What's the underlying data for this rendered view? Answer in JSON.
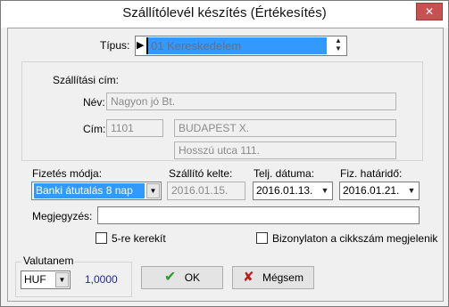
{
  "window": {
    "title": "Szállítólevél készítés (Értékesítés)",
    "close_label": "✕"
  },
  "tipus": {
    "label": "Típus:",
    "value": "01 Kereskedelem",
    "pointer": "▶"
  },
  "address": {
    "section_label": "Szállítási cím:",
    "name_label": "Név:",
    "name_value": "Nagyon jó Bt.",
    "address_label": "Cím:",
    "zip_value": "1101",
    "city_value": "BUDAPEST X.",
    "street_value": "Hosszú utca 111."
  },
  "payment": {
    "label": "Fizetés módja:",
    "value": "Banki átutalás   8 nap",
    "delivery_date_label": "Szállító kelte:",
    "delivery_date_value": "2016.01.15.",
    "perf_date_label": "Telj. dátuma:",
    "perf_date_value": "2016.01.13.",
    "due_date_label": "Fiz. határidő:",
    "due_date_value": "2016.01.21."
  },
  "note": {
    "label": "Megjegyzés:",
    "value": ""
  },
  "checkboxes": {
    "round5_label": "5-re kerekít",
    "show_item_no_label": "Bizonylaton a cikkszám megjelenik"
  },
  "currency": {
    "group_label": "Valutanem",
    "value": "HUF",
    "rate": "1,0000"
  },
  "buttons": {
    "ok_label": "OK",
    "ok_icon": "✔",
    "cancel_label": "Mégsem",
    "cancel_icon": "✘"
  },
  "colors": {
    "selection": "#3399ff",
    "ok_icon": "#2e9b2e",
    "cancel_icon": "#b81e1e",
    "rate_text": "#1f2a9a"
  }
}
